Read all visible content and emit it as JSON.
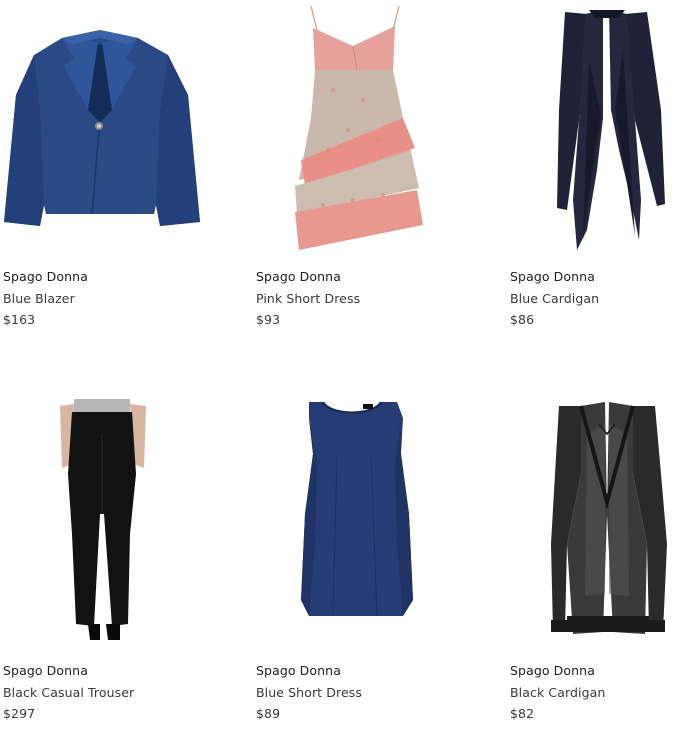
{
  "products": [
    {
      "brand": "Spago Donna",
      "name": "Blue Blazer",
      "price": "$163",
      "color": "#2a4a86"
    },
    {
      "brand": "Spago Donna",
      "name": "Pink Short Dress",
      "price": "$93",
      "color": "#e79a8f"
    },
    {
      "brand": "Spago Donna",
      "name": "Blue Cardigan",
      "price": "$86",
      "color": "#1f2338"
    },
    {
      "brand": "Spago Donna",
      "name": "Black Casual Trouser",
      "price": "$297",
      "color": "#111111"
    },
    {
      "brand": "Spago Donna",
      "name": "Blue Short Dress",
      "price": "$89",
      "color": "#253d74"
    },
    {
      "brand": "Spago Donna",
      "name": "Black Cardigan",
      "price": "$82",
      "color": "#1b1b1b"
    }
  ]
}
